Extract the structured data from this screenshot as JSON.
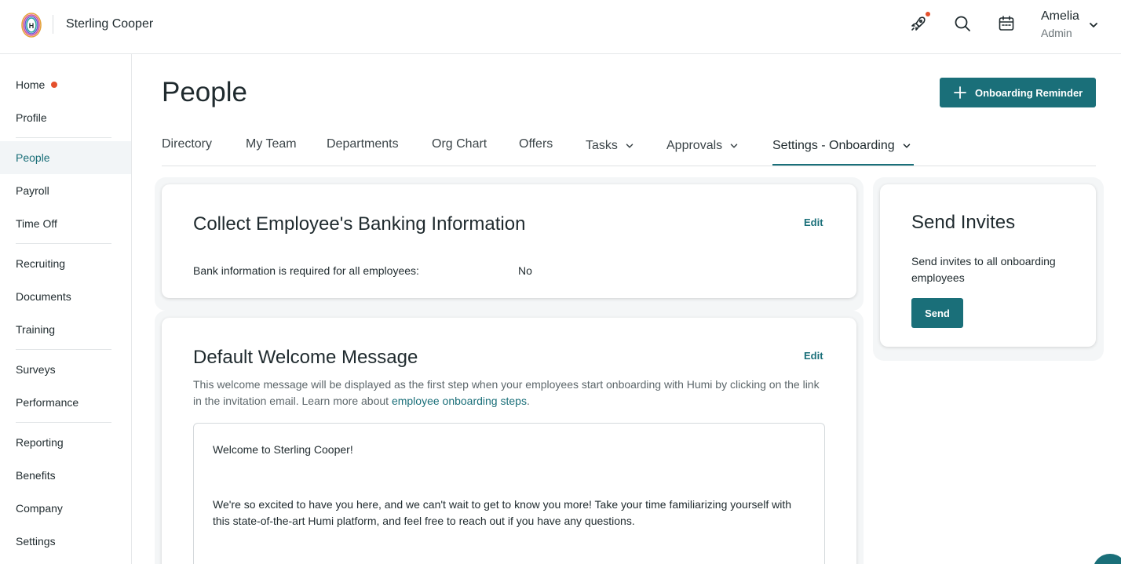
{
  "colors": {
    "accent": "#1a6f79",
    "notification": "#e4502c"
  },
  "header": {
    "company": "Sterling Cooper",
    "user": {
      "name": "Amelia",
      "role": "Admin"
    },
    "icons": [
      "rocket-icon",
      "search-icon",
      "calendar-icon",
      "chevron-down-icon"
    ]
  },
  "sidebar": {
    "items": [
      {
        "label": "Home"
      },
      {
        "label": "Profile"
      },
      {
        "label": "People"
      },
      {
        "label": "Payroll"
      },
      {
        "label": "Time Off"
      },
      {
        "label": "Recruiting"
      },
      {
        "label": "Documents"
      },
      {
        "label": "Training"
      },
      {
        "label": "Surveys"
      },
      {
        "label": "Performance"
      },
      {
        "label": "Reporting"
      },
      {
        "label": "Benefits"
      },
      {
        "label": "Company"
      },
      {
        "label": "Settings"
      }
    ],
    "active": "People"
  },
  "main": {
    "title": "People",
    "reminder_button": "Onboarding Reminder",
    "tabs": [
      {
        "label": "Directory"
      },
      {
        "label": "My Team"
      },
      {
        "label": "Departments"
      },
      {
        "label": "Org Chart"
      },
      {
        "label": "Offers"
      },
      {
        "label": "Tasks"
      },
      {
        "label": "Approvals"
      },
      {
        "label": "Settings - Onboarding"
      }
    ],
    "active_tab": "Settings - Onboarding",
    "banking": {
      "title": "Collect Employee's Banking Information",
      "edit": "Edit",
      "field_label": "Bank information is required for all employees:",
      "field_value": "No"
    },
    "welcome": {
      "title": "Default Welcome Message",
      "edit": "Edit",
      "description_part1": "This welcome message will be displayed as the first step when your employees start onboarding with Humi by clicking on the link",
      "description_part2": "in the invitation email. Learn more about",
      "description_link": "employee onboarding steps",
      "description_end": ".",
      "message_line1": "Welcome to Sterling Cooper!",
      "message_line2": "We're so excited to have you here, and we can't wait to get to know you more! Take your time familiarizing yourself with",
      "message_line3": "this state-of-the-art Humi platform, and feel free to reach out if you have any questions."
    },
    "invites": {
      "title": "Send Invites",
      "description_line1": "Send invites to all onboarding",
      "description_line2": "employees",
      "button": "Send"
    }
  }
}
